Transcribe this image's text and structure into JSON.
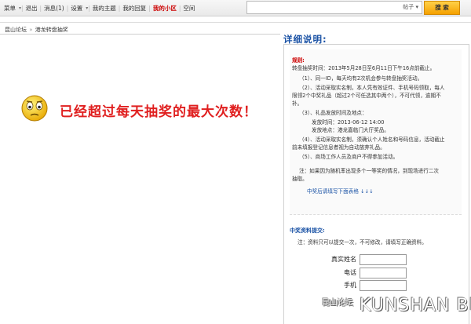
{
  "topnav": {
    "items": [
      {
        "label": "菜单",
        "caret": true,
        "red": false
      },
      {
        "label": "退出",
        "caret": false,
        "red": false
      },
      {
        "label": "消息(1)",
        "caret": false,
        "red": false
      },
      {
        "label": "设置",
        "caret": true,
        "red": false
      },
      {
        "label": "我的主题",
        "caret": false,
        "red": false
      },
      {
        "label": "我的回复",
        "caret": false,
        "red": false
      },
      {
        "label": "我的小区",
        "caret": false,
        "red": true
      },
      {
        "label": "空间",
        "caret": false,
        "red": false
      }
    ]
  },
  "search": {
    "placeholder": "",
    "scope": "帖子 ▾",
    "button": "搜 索"
  },
  "breadcrumb": {
    "home": "昆山论坛",
    "arrow": "»",
    "current": "港龙转盘抽奖"
  },
  "message": "已经超过每天抽奖的最大次数！",
  "panel": {
    "title": "详细说明:",
    "rules_heading": "规则:",
    "rules": [
      "转盘抽奖时间：2013年5月28日至6月11日下午16点前截止。",
      "（1）、同一ID，每天均有2次机会参与转盘抽奖活动。",
      "（2）、活动采取实名制，本人凭有效证件、手机号码领取，每人",
      "限领2个中奖礼品（超过2个可任选其中两个），不可代领，逾期不",
      "补。",
      "（3）、礼品发放时间及地点：",
      "发放时间：2013-06-12 14:00",
      "发放地点：港龙嘉临门大厅奖品。",
      "（4）、活动采取实名制，须确认个人姓名和号码信息，活动截止",
      "前未填报登记信息者视为自动放弃礼品。",
      "（5）、商场工作人员及商户不得参加活动。",
      "注：如果因为随机率出现多个一等奖的情况，到现场进行二次",
      "抽取。"
    ],
    "form_link": "中奖后请填写下面表格 ↓↓↓",
    "prize_heading": "中奖资料提交:",
    "prize_note": "注：资料只可以提交一次，不可修改，请填写正确资料。",
    "fields": [
      {
        "label": "真实姓名",
        "value": ""
      },
      {
        "label": "电话",
        "value": ""
      },
      {
        "label": "手机",
        "value": ""
      }
    ]
  },
  "watermark": {
    "small": "昆山论坛",
    "text": "KUNSHAN BBS"
  }
}
